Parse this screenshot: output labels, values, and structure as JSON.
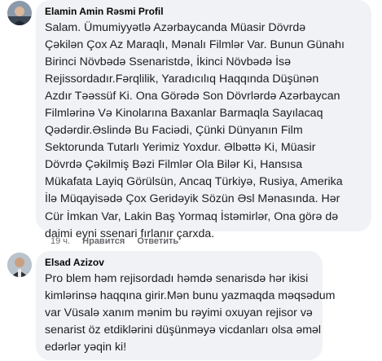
{
  "comments": [
    {
      "author": "Elamin Amin Rəsmi Profil",
      "lines": [
        "Salam. Ümumiyyətlə Azərbaycanda Müasir Dövrdə",
        "Çəkilən Çox Az Maraqlı, Mənalı Filmlər Var. Bunun Günahı",
        "Birinci Növbədə Ssenaristdə, İkinci Növbədə İsə",
        "Rejissordadır.Fərqlilik, Yaradıcılıq Haqqında Düşünən",
        "Azdır Təəssüf Ki. Ona Görədə Son Dövrlərdə Azərbaycan",
        "Filmlərinə Və Kinolarına Baxanlar Barmaqla Sayılacaq",
        "Qədərdir.Əslində Bu Faciədi, Çünki Dünyanın Film",
        "Sektorunda Tutarlı Yerimiz Yoxdur. Əlbəttə Ki, Müasir",
        "Dövrdə Çəkilmiş Bəzi Filmlər Ola Bilər Ki, Hansısa",
        "Mükafata Layiq Görülsün, Ancaq Türkiyə, Rusiya, Amerika",
        "İlə Müqayisədə Çox Geridəyik Sözün Əsl Mənasında. Hər",
        "Cür İmkan Var, Lakin Baş Yormaq İstəmirlər, Ona görə də",
        "daimi eyni ssenari fırlanır çarxda."
      ],
      "time": "19 ч.",
      "like_label": "Нравится",
      "reply_label": "Ответить"
    },
    {
      "author": "Elsad Azizov",
      "lines": [
        "Pro blem həm rejisordadı həmdə senarisdə hər ikisi",
        "kimlərinsə haqqına girir.Mən bunu yazmaqda məqsədum",
        "var Vüsalə xanım mənim bu rəyimi oxuyan rejisor və",
        "senarist öz etdiklərini düşünməyə vicdanları olsa əməl",
        "edərlər yəqin ki!"
      ]
    }
  ],
  "colors": {
    "bubble": "#f0f2f5",
    "secondary_text": "#65676b"
  }
}
